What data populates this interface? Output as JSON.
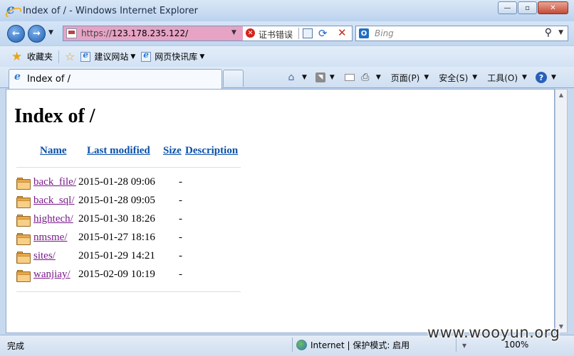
{
  "window": {
    "title": "Index of / - Windows Internet Explorer",
    "controls": {
      "minimize": "—",
      "maximize": "▫",
      "close": "✕"
    }
  },
  "address_bar": {
    "scheme": "https://",
    "host": "123.178.235.122/",
    "cert_error": "证书错误"
  },
  "search": {
    "placeholder": "Bing",
    "provider_icon": "bing-outlook-icon"
  },
  "favorites_bar": {
    "favorites_label": "收藏夹",
    "links": [
      {
        "label": "建议网站"
      },
      {
        "label": "网页快讯库"
      }
    ]
  },
  "tab": {
    "title": "Index of /"
  },
  "command_bar": {
    "page": "页面(P)",
    "safety": "安全(S)",
    "tools": "工具(O)"
  },
  "listing": {
    "heading": "Index of /",
    "columns": [
      "Name",
      "Last modified",
      "Size",
      "Description"
    ],
    "rows": [
      {
        "name": "back_file/",
        "modified": "2015-01-28 09:06",
        "size": "-"
      },
      {
        "name": "back_sql/",
        "modified": "2015-01-28 09:05",
        "size": "-"
      },
      {
        "name": "hightech/",
        "modified": "2015-01-30 18:26",
        "size": "-"
      },
      {
        "name": "nmsme/",
        "modified": "2015-01-27 18:16",
        "size": "-"
      },
      {
        "name": "sites/",
        "modified": "2015-01-29 14:21",
        "size": "-"
      },
      {
        "name": "wanjiay/",
        "modified": "2015-02-09 10:19",
        "size": "-"
      }
    ]
  },
  "status_bar": {
    "status": "完成",
    "zone": "Internet | 保护模式: 启用",
    "zoom": "100%"
  },
  "watermark": "www.wooyun.org",
  "colors": {
    "link": "#0a50a8",
    "visited_link": "#7a1a8a",
    "cert_error_bg": "#e6a3c4"
  }
}
